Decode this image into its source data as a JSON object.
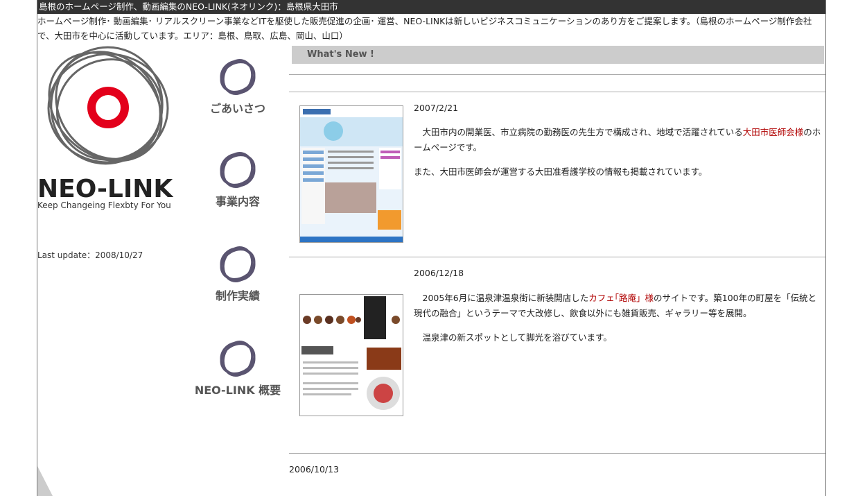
{
  "header": {
    "title": "島根のホームページ制作、動画編集のNEO-LINK(ネオリンク)：島根県大田市",
    "intro": "ホームページ制作･ 動画編集･ リアルスクリーン事業などITを駆使した販売促進の企画･ 運営、NEO-LINKは新しいビジネスコミュニケーションのあり方をご提案します。（島根のホームページ制作会社で、大田市を中心に活動しています。エリア：島根、鳥取、広島、岡山、山口）"
  },
  "logo": {
    "name": "NEO-LINK",
    "tagline": "Keep Changeing Flexbty For You",
    "accent_color": "#e3001b"
  },
  "sidebar": {
    "last_update": "Last update：2008/10/27",
    "nav": [
      {
        "label": "ごあいさつ"
      },
      {
        "label": "事業内容"
      },
      {
        "label": "制作実績"
      },
      {
        "label": "NEO-LINK 概要"
      }
    ]
  },
  "news": {
    "heading": "What's New !",
    "items": [
      {
        "date": "2007/2/21",
        "para1_pre": "　大田市内の開業医、市立病院の勤務医の先生方で構成され、地域で活躍されている",
        "para1_link": "大田市医師会様",
        "para1_post": "のホームページです。",
        "para2": "また、大田市医師会が運営する大田准看護学校の情報も掲載されています。"
      },
      {
        "date": "2006/12/18",
        "para1_pre": "　2005年6月に温泉津温泉街に新装開店した",
        "para1_link": "カフェ｢路庵」様",
        "para1_post": "のサイトです。築100年の町屋を「伝統と現代の融合」というテーマで大改修し、飲食以外にも雑貨販売、ギャラリー等を展開。",
        "para2": "　温泉津の新スポットとして脚光を浴びています。"
      },
      {
        "date": "2006/10/13"
      }
    ]
  }
}
